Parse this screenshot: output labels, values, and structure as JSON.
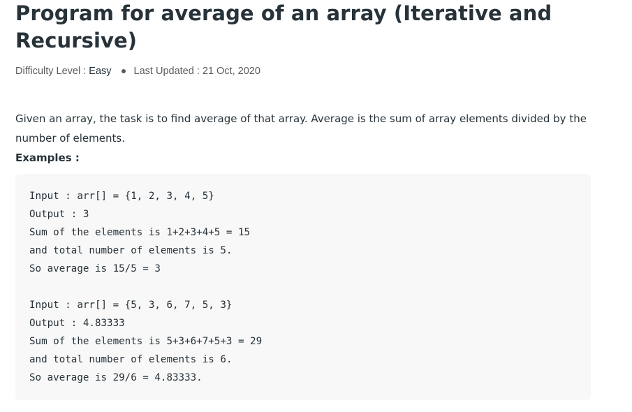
{
  "article": {
    "title": "Program for average of an array (Iterative and Recursive)",
    "meta": {
      "difficulty_label": "Difficulty Level :",
      "difficulty_value": "Easy",
      "updated_label": "Last Updated :",
      "updated_value": "21 Oct, 2020"
    },
    "intro": "Given an array, the task is to find average of that array. Average is the sum of array elements divided by the number of elements.",
    "examples_label": "Examples :",
    "code_lines": [
      "Input : arr[] = {1, 2, 3, 4, 5}",
      "Output : 3",
      "Sum of the elements is 1+2+3+4+5 = 15",
      "and total number of elements is 5.",
      "So average is 15/5 = 3",
      "",
      "Input : arr[] = {5, 3, 6, 7, 5, 3}",
      "Output : 4.83333",
      "Sum of the elements is 5+3+6+7+5+3 = 29",
      "and total number of elements is 6.",
      "So average is 29/6 = 4.83333."
    ]
  }
}
